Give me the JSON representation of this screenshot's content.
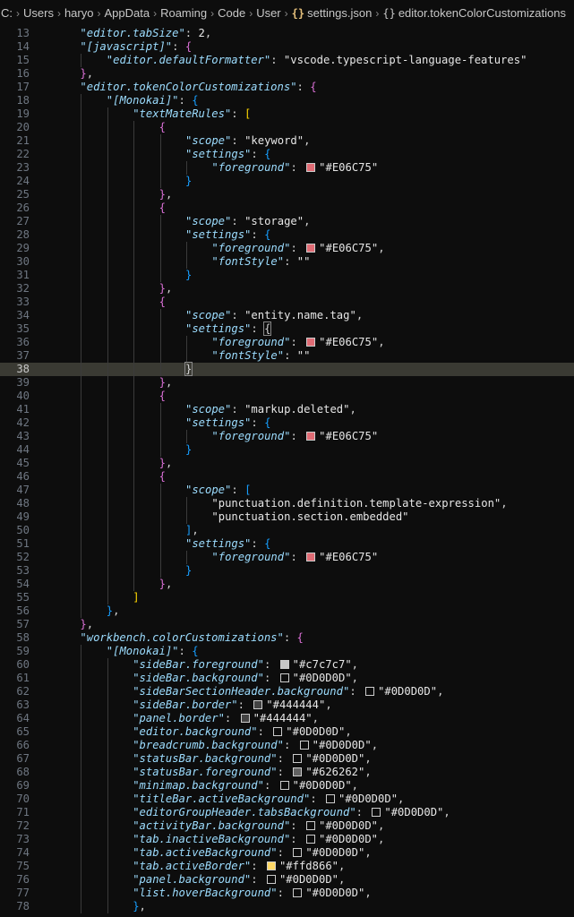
{
  "breadcrumb": {
    "drive": "C:",
    "folders": [
      "Users",
      "haryo",
      "AppData",
      "Roaming",
      "Code",
      "User"
    ],
    "file": "settings.json",
    "symbol": "editor.tokenColorCustomizations"
  },
  "editor": {
    "first_line": 13,
    "current_line": 38,
    "lines": [
      [
        [
          "k",
          "\"editor.tabSize\""
        ],
        [
          "p",
          ": "
        ],
        [
          "n",
          "2"
        ],
        [
          "p",
          ","
        ]
      ],
      [
        [
          "k",
          "\"[javascript]\""
        ],
        [
          "p",
          ": "
        ],
        [
          "b1",
          "{"
        ]
      ],
      [
        [
          "k",
          "\"editor.defaultFormatter\""
        ],
        [
          "p",
          ": "
        ],
        [
          "s",
          "\"vscode.typescript-language-features\""
        ]
      ],
      [
        [
          "b1",
          "}"
        ],
        [
          "p",
          ","
        ]
      ],
      [
        [
          "k",
          "\"editor.tokenColorCustomizations\""
        ],
        [
          "p",
          ": "
        ],
        [
          "b1",
          "{"
        ]
      ],
      [
        [
          "k",
          "\"[Monokai]\""
        ],
        [
          "p",
          ": "
        ],
        [
          "b2",
          "{"
        ]
      ],
      [
        [
          "k",
          "\"textMateRules\""
        ],
        [
          "p",
          ": "
        ],
        [
          "b0",
          "["
        ]
      ],
      [
        [
          "b1",
          "{"
        ]
      ],
      [
        [
          "k",
          "\"scope\""
        ],
        [
          "p",
          ": "
        ],
        [
          "s",
          "\"keyword\""
        ],
        [
          "p",
          ","
        ]
      ],
      [
        [
          "k",
          "\"settings\""
        ],
        [
          "p",
          ": "
        ],
        [
          "b2",
          "{"
        ]
      ],
      [
        [
          "k",
          "\"foreground\""
        ],
        [
          "p",
          ": "
        ],
        [
          "sw",
          "#E06C75"
        ],
        [
          "s",
          "\"#E06C75\""
        ]
      ],
      [
        [
          "b2",
          "}"
        ]
      ],
      [
        [
          "b1",
          "}"
        ],
        [
          "p",
          ","
        ]
      ],
      [
        [
          "b1",
          "{"
        ]
      ],
      [
        [
          "k",
          "\"scope\""
        ],
        [
          "p",
          ": "
        ],
        [
          "s",
          "\"storage\""
        ],
        [
          "p",
          ","
        ]
      ],
      [
        [
          "k",
          "\"settings\""
        ],
        [
          "p",
          ": "
        ],
        [
          "b2",
          "{"
        ]
      ],
      [
        [
          "k",
          "\"foreground\""
        ],
        [
          "p",
          ": "
        ],
        [
          "sw",
          "#E06C75"
        ],
        [
          "s",
          "\"#E06C75\""
        ],
        [
          "p",
          ","
        ]
      ],
      [
        [
          "k",
          "\"fontStyle\""
        ],
        [
          "p",
          ": "
        ],
        [
          "s",
          "\"\""
        ]
      ],
      [
        [
          "b2",
          "}"
        ]
      ],
      [
        [
          "b1",
          "}"
        ],
        [
          "p",
          ","
        ]
      ],
      [
        [
          "b1",
          "{"
        ]
      ],
      [
        [
          "k",
          "\"scope\""
        ],
        [
          "p",
          ": "
        ],
        [
          "s",
          "\"entity.name.tag\""
        ],
        [
          "p",
          ","
        ]
      ],
      [
        [
          "k",
          "\"settings\""
        ],
        [
          "p",
          ": "
        ],
        [
          "bm",
          "{"
        ]
      ],
      [
        [
          "k",
          "\"foreground\""
        ],
        [
          "p",
          ": "
        ],
        [
          "sw",
          "#E06C75"
        ],
        [
          "s",
          "\"#E06C75\""
        ],
        [
          "p",
          ","
        ]
      ],
      [
        [
          "k",
          "\"fontStyle\""
        ],
        [
          "p",
          ": "
        ],
        [
          "s",
          "\"\""
        ]
      ],
      [
        [
          "bm",
          "}"
        ],
        [
          "caret",
          ""
        ]
      ],
      [
        [
          "b1",
          "}"
        ],
        [
          "p",
          ","
        ]
      ],
      [
        [
          "b1",
          "{"
        ]
      ],
      [
        [
          "k",
          "\"scope\""
        ],
        [
          "p",
          ": "
        ],
        [
          "s",
          "\"markup.deleted\""
        ],
        [
          "p",
          ","
        ]
      ],
      [
        [
          "k",
          "\"settings\""
        ],
        [
          "p",
          ": "
        ],
        [
          "b2",
          "{"
        ]
      ],
      [
        [
          "k",
          "\"foreground\""
        ],
        [
          "p",
          ": "
        ],
        [
          "sw",
          "#E06C75"
        ],
        [
          "s",
          "\"#E06C75\""
        ]
      ],
      [
        [
          "b2",
          "}"
        ]
      ],
      [
        [
          "b1",
          "}"
        ],
        [
          "p",
          ","
        ]
      ],
      [
        [
          "b1",
          "{"
        ]
      ],
      [
        [
          "k",
          "\"scope\""
        ],
        [
          "p",
          ": "
        ],
        [
          "b2",
          "["
        ]
      ],
      [
        [
          "s",
          "\"punctuation.definition.template-expression\""
        ],
        [
          "p",
          ","
        ]
      ],
      [
        [
          "s",
          "\"punctuation.section.embedded\""
        ]
      ],
      [
        [
          "b2",
          "]"
        ],
        [
          "p",
          ","
        ]
      ],
      [
        [
          "k",
          "\"settings\""
        ],
        [
          "p",
          ": "
        ],
        [
          "b2",
          "{"
        ]
      ],
      [
        [
          "k",
          "\"foreground\""
        ],
        [
          "p",
          ": "
        ],
        [
          "sw",
          "#E06C75"
        ],
        [
          "s",
          "\"#E06C75\""
        ]
      ],
      [
        [
          "b2",
          "}"
        ]
      ],
      [
        [
          "b1",
          "}"
        ],
        [
          "p",
          ","
        ]
      ],
      [
        [
          "b0",
          "]"
        ]
      ],
      [
        [
          "b2",
          "}"
        ],
        [
          "p",
          ","
        ]
      ],
      [
        [
          "b1",
          "}"
        ],
        [
          "p",
          ","
        ]
      ],
      [
        [
          "k",
          "\"workbench.colorCustomizations\""
        ],
        [
          "p",
          ": "
        ],
        [
          "b1",
          "{"
        ]
      ],
      [
        [
          "k",
          "\"[Monokai]\""
        ],
        [
          "p",
          ": "
        ],
        [
          "b2",
          "{"
        ]
      ],
      [
        [
          "k",
          "\"sideBar.foreground\""
        ],
        [
          "p",
          ": "
        ],
        [
          "sw",
          "#c7c7c7"
        ],
        [
          "s",
          "\"#c7c7c7\""
        ],
        [
          "p",
          ","
        ]
      ],
      [
        [
          "k",
          "\"sideBar.background\""
        ],
        [
          "p",
          ": "
        ],
        [
          "sw",
          "#0D0D0D"
        ],
        [
          "s",
          "\"#0D0D0D\""
        ],
        [
          "p",
          ","
        ]
      ],
      [
        [
          "k",
          "\"sideBarSectionHeader.background\""
        ],
        [
          "p",
          ": "
        ],
        [
          "sw",
          "#0D0D0D"
        ],
        [
          "s",
          "\"#0D0D0D\""
        ],
        [
          "p",
          ","
        ]
      ],
      [
        [
          "k",
          "\"sideBar.border\""
        ],
        [
          "p",
          ": "
        ],
        [
          "sw",
          "#444444"
        ],
        [
          "s",
          "\"#444444\""
        ],
        [
          "p",
          ","
        ]
      ],
      [
        [
          "k",
          "\"panel.border\""
        ],
        [
          "p",
          ": "
        ],
        [
          "sw",
          "#444444"
        ],
        [
          "s",
          "\"#444444\""
        ],
        [
          "p",
          ","
        ]
      ],
      [
        [
          "k",
          "\"editor.background\""
        ],
        [
          "p",
          ": "
        ],
        [
          "sw",
          "#0D0D0D"
        ],
        [
          "s",
          "\"#0D0D0D\""
        ],
        [
          "p",
          ","
        ]
      ],
      [
        [
          "k",
          "\"breadcrumb.background\""
        ],
        [
          "p",
          ": "
        ],
        [
          "sw",
          "#0D0D0D"
        ],
        [
          "s",
          "\"#0D0D0D\""
        ],
        [
          "p",
          ","
        ]
      ],
      [
        [
          "k",
          "\"statusBar.background\""
        ],
        [
          "p",
          ": "
        ],
        [
          "sw",
          "#0D0D0D"
        ],
        [
          "s",
          "\"#0D0D0D\""
        ],
        [
          "p",
          ","
        ]
      ],
      [
        [
          "k",
          "\"statusBar.foreground\""
        ],
        [
          "p",
          ": "
        ],
        [
          "sw",
          "#626262"
        ],
        [
          "s",
          "\"#626262\""
        ],
        [
          "p",
          ","
        ]
      ],
      [
        [
          "k",
          "\"minimap.background\""
        ],
        [
          "p",
          ": "
        ],
        [
          "sw",
          "#0D0D0D"
        ],
        [
          "s",
          "\"#0D0D0D\""
        ],
        [
          "p",
          ","
        ]
      ],
      [
        [
          "k",
          "\"titleBar.activeBackground\""
        ],
        [
          "p",
          ": "
        ],
        [
          "sw",
          "#0D0D0D"
        ],
        [
          "s",
          "\"#0D0D0D\""
        ],
        [
          "p",
          ","
        ]
      ],
      [
        [
          "k",
          "\"editorGroupHeader.tabsBackground\""
        ],
        [
          "p",
          ": "
        ],
        [
          "sw",
          "#0D0D0D"
        ],
        [
          "s",
          "\"#0D0D0D\""
        ],
        [
          "p",
          ","
        ]
      ],
      [
        [
          "k",
          "\"activityBar.background\""
        ],
        [
          "p",
          ": "
        ],
        [
          "sw",
          "#0D0D0D"
        ],
        [
          "s",
          "\"#0D0D0D\""
        ],
        [
          "p",
          ","
        ]
      ],
      [
        [
          "k",
          "\"tab.inactiveBackground\""
        ],
        [
          "p",
          ": "
        ],
        [
          "sw",
          "#0D0D0D"
        ],
        [
          "s",
          "\"#0D0D0D\""
        ],
        [
          "p",
          ","
        ]
      ],
      [
        [
          "k",
          "\"tab.activeBackground\""
        ],
        [
          "p",
          ": "
        ],
        [
          "sw",
          "#0D0D0D"
        ],
        [
          "s",
          "\"#0D0D0D\""
        ],
        [
          "p",
          ","
        ]
      ],
      [
        [
          "k",
          "\"tab.activeBorder\""
        ],
        [
          "p",
          ": "
        ],
        [
          "sw",
          "#ffd866"
        ],
        [
          "s",
          "\"#ffd866\""
        ],
        [
          "p",
          ","
        ]
      ],
      [
        [
          "k",
          "\"panel.background\""
        ],
        [
          "p",
          ": "
        ],
        [
          "sw",
          "#0D0D0D"
        ],
        [
          "s",
          "\"#0D0D0D\""
        ],
        [
          "p",
          ","
        ]
      ],
      [
        [
          "k",
          "\"list.hoverBackground\""
        ],
        [
          "p",
          ": "
        ],
        [
          "sw",
          "#0D0D0D"
        ],
        [
          "s",
          "\"#0D0D0D\""
        ],
        [
          "p",
          ","
        ]
      ],
      [
        [
          "b2",
          "}"
        ],
        [
          "p",
          ","
        ]
      ]
    ]
  }
}
